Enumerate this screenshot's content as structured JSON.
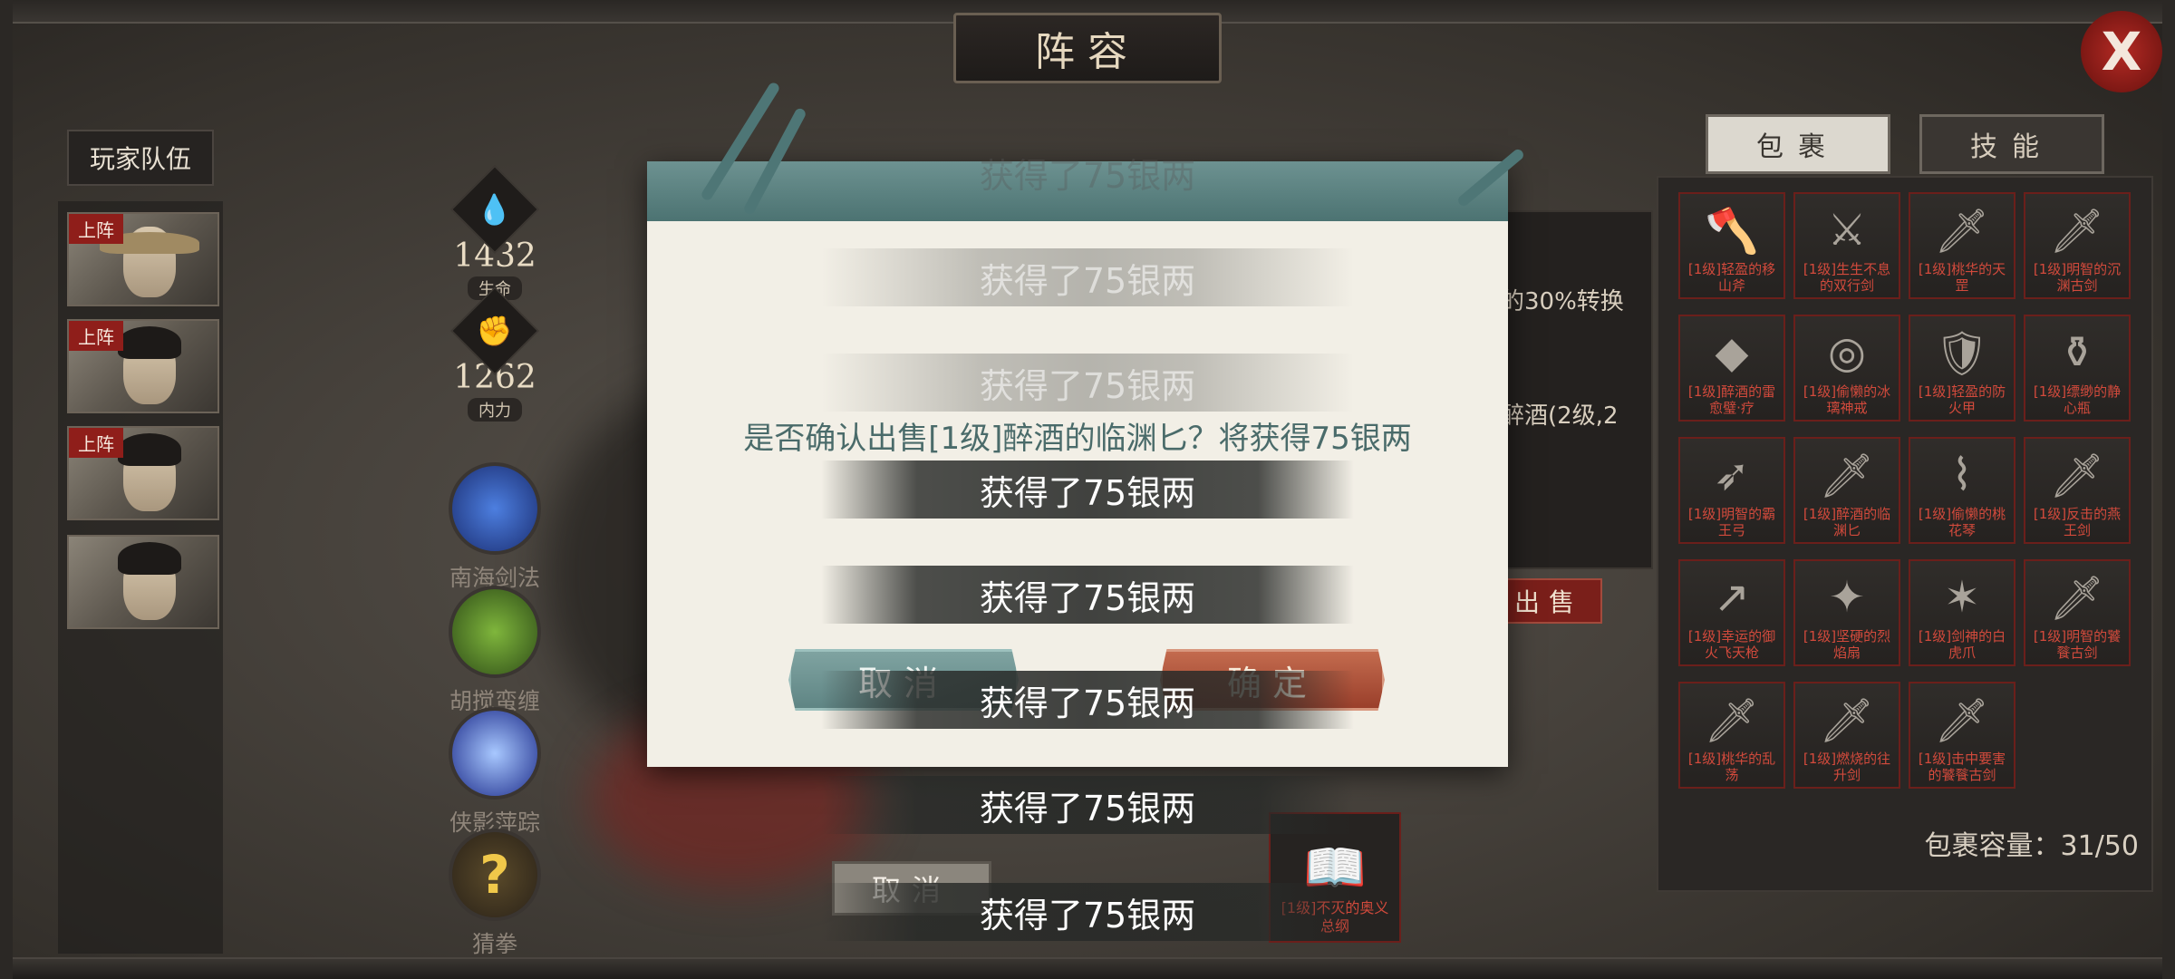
{
  "screen": {
    "title": "阵容",
    "close_label": "X"
  },
  "team": {
    "label": "玩家队伍",
    "members": [
      {
        "tag": "上阵"
      },
      {
        "tag": "上阵"
      },
      {
        "tag": "上阵"
      },
      {
        "tag": ""
      }
    ]
  },
  "stats": [
    {
      "icon": "water-drop-icon",
      "value": "1432",
      "label": "生命"
    },
    {
      "icon": "muscle-icon",
      "value": "1262",
      "label": "内力"
    }
  ],
  "skills": [
    {
      "icon": "blue-sword-icon",
      "name": "南海剑法"
    },
    {
      "icon": "green-figure-icon",
      "name": "胡搅蛮缠"
    },
    {
      "icon": "moon-figure-icon",
      "name": "侠影萍踪"
    },
    {
      "icon": "question-mark-icon",
      "name": "猜拳",
      "glyph": "?"
    }
  ],
  "bag": {
    "tab_bag": "包裹",
    "tab_skill": "技能",
    "capacity": "包裹容量：31/50",
    "items": [
      {
        "name": "[1级]轻盈的移山斧",
        "icon": "axe-icon"
      },
      {
        "name": "[1级]生生不息的双行剑",
        "icon": "twin-sword-icon"
      },
      {
        "name": "[1级]桃华的天罡",
        "icon": "sword-icon"
      },
      {
        "name": "[1级]明智的沉渊古剑",
        "icon": "sword-icon"
      },
      {
        "name": "[1级]醉酒的雷愈璧·疗",
        "icon": "jade-icon"
      },
      {
        "name": "[1级]偷懒的冰璃神戒",
        "icon": "ring-icon"
      },
      {
        "name": "[1级]轻盈的防火甲",
        "icon": "armor-icon"
      },
      {
        "name": "[1级]缥缈的静心瓶",
        "icon": "vase-icon"
      },
      {
        "name": "[1级]明智的霸王弓",
        "icon": "bow-icon"
      },
      {
        "name": "[1级]醉酒的临渊匕",
        "icon": "dagger-icon"
      },
      {
        "name": "[1级]偷懒的桃花琴",
        "icon": "flute-icon"
      },
      {
        "name": "[1级]反击的燕王剑",
        "icon": "sword-icon"
      },
      {
        "name": "[1级]幸运的御火飞天枪",
        "icon": "spear-icon"
      },
      {
        "name": "[1级]坚硬的烈焰扇",
        "icon": "fan-icon"
      },
      {
        "name": "[1级]剑神的白虎爪",
        "icon": "claw-icon"
      },
      {
        "name": "[1级]明智的饕餮古剑",
        "icon": "sword-icon"
      },
      {
        "name": "[1级]桃华的乱荡",
        "icon": "sword-icon"
      },
      {
        "name": "[1级]燃烧的往升剑",
        "icon": "sword-icon"
      },
      {
        "name": "[1级]击中要害的饕餮古剑",
        "icon": "sword-icon"
      }
    ]
  },
  "detail": {
    "line1": "的30%转换",
    "line2": "醉酒(2级,2",
    "sell_label": "出售",
    "book_name": "[1级]不灭的奥义总纲",
    "bottom_cancel": "取消"
  },
  "dialog": {
    "message": "是否确认出售[1级]醉酒的临渊匕？将获得75银两",
    "cancel_label": "取消",
    "confirm_label": "确定"
  },
  "toasts": [
    "获得了75银两",
    "获得了75银两",
    "获得了75银两",
    "获得了75银两",
    "获得了75银两",
    "获得了75银两",
    "获得了75银两",
    "获得了75银两"
  ],
  "colors": {
    "accent_red": "#8f1e1a",
    "teal": "#5f8584",
    "parchment": "#f2efe6"
  }
}
